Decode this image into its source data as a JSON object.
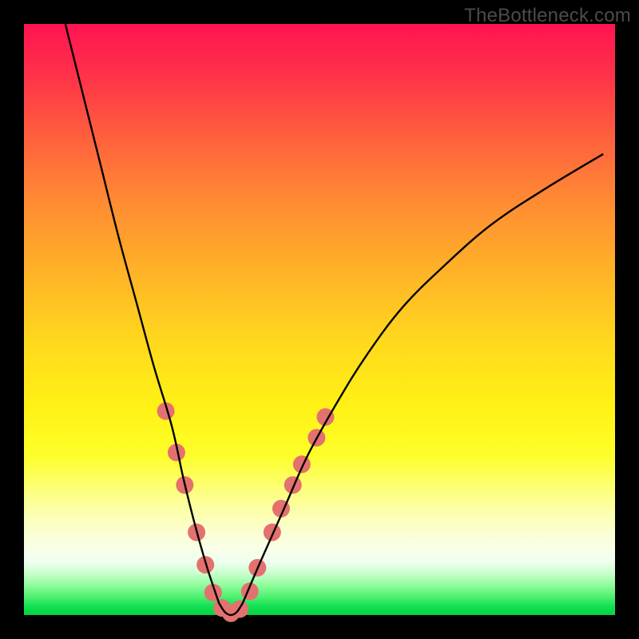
{
  "watermark": "TheBottleneck.com",
  "chart_data": {
    "type": "line",
    "title": "",
    "xlabel": "",
    "ylabel": "",
    "xlim": [
      0,
      100
    ],
    "ylim": [
      0,
      100
    ],
    "gradient_bands": [
      {
        "color": "#ff1452",
        "stop_pct": 0
      },
      {
        "color": "#ff8b33",
        "stop_pct": 30
      },
      {
        "color": "#fff215",
        "stop_pct": 65
      },
      {
        "color": "#fbffd1",
        "stop_pct": 86
      },
      {
        "color": "#03d33e",
        "stop_pct": 100
      }
    ],
    "series": [
      {
        "name": "left-arm",
        "stroke": "#000000",
        "x": [
          7,
          10,
          13,
          16,
          19,
          22,
          25,
          27,
          29,
          31,
          33
        ],
        "y": [
          100,
          88,
          76,
          64,
          53,
          42,
          32,
          23,
          15,
          8,
          2
        ]
      },
      {
        "name": "right-arm",
        "stroke": "#000000",
        "x": [
          37,
          40,
          44,
          48,
          53,
          58,
          64,
          71,
          79,
          88,
          98
        ],
        "y": [
          2,
          9,
          18,
          27,
          36,
          44,
          52,
          59,
          66,
          72,
          78
        ]
      },
      {
        "name": "floor",
        "stroke": "#000000",
        "x": [
          33,
          34,
          35,
          36,
          37
        ],
        "y": [
          2,
          0.5,
          0,
          0.5,
          2
        ]
      }
    ],
    "markers": {
      "name": "highlight-dots",
      "color": "#e4716f",
      "radius": 11,
      "points": [
        {
          "x": 24.0,
          "y": 34.5
        },
        {
          "x": 25.8,
          "y": 27.5
        },
        {
          "x": 27.2,
          "y": 22.0
        },
        {
          "x": 29.2,
          "y": 14.0
        },
        {
          "x": 30.7,
          "y": 8.5
        },
        {
          "x": 32.0,
          "y": 3.8
        },
        {
          "x": 33.5,
          "y": 1.2
        },
        {
          "x": 35.0,
          "y": 0.3
        },
        {
          "x": 36.5,
          "y": 1.0
        },
        {
          "x": 38.2,
          "y": 4.0
        },
        {
          "x": 39.5,
          "y": 8.0
        },
        {
          "x": 42.0,
          "y": 14.0
        },
        {
          "x": 43.5,
          "y": 18.0
        },
        {
          "x": 45.5,
          "y": 22.0
        },
        {
          "x": 47.0,
          "y": 25.5
        },
        {
          "x": 49.5,
          "y": 30.0
        },
        {
          "x": 51.0,
          "y": 33.5
        }
      ]
    }
  }
}
